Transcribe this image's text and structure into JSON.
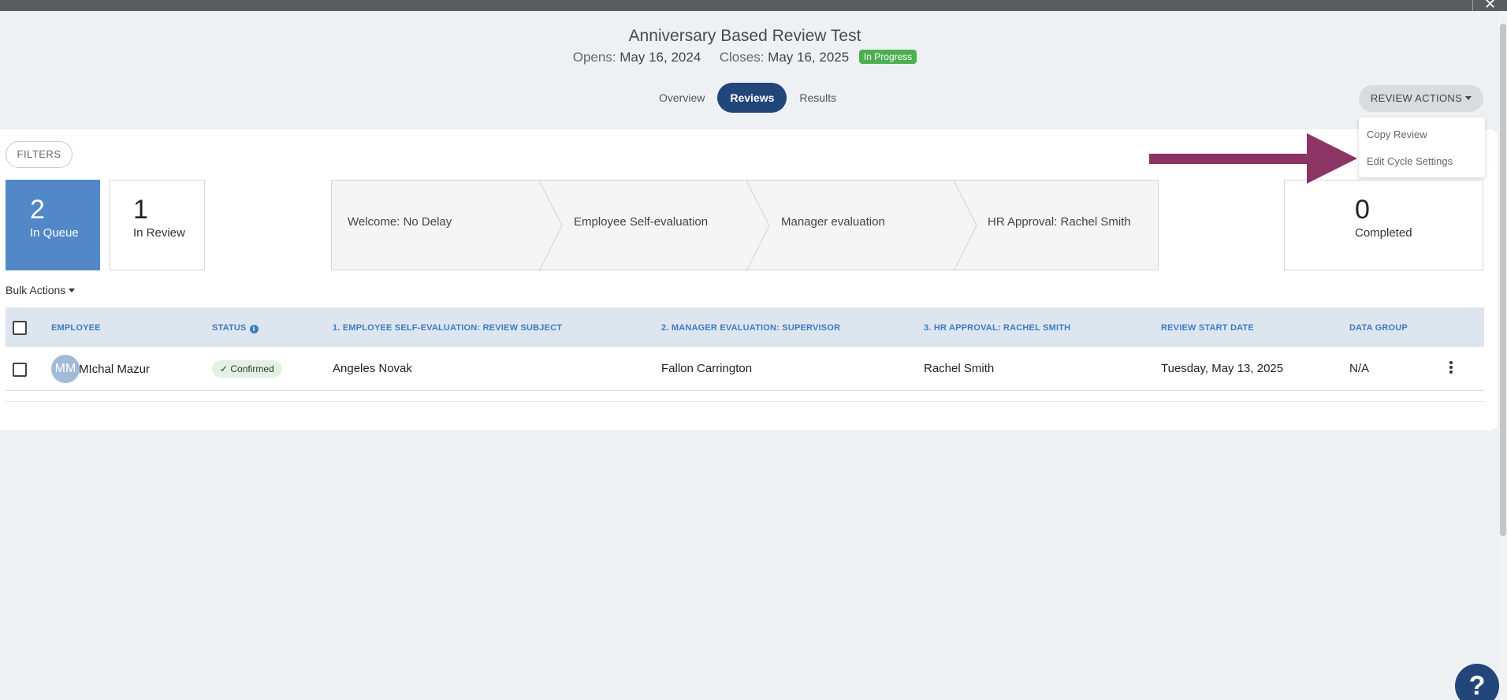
{
  "header": {
    "title": "Anniversary Based Review Test",
    "opens_label": "Opens:",
    "opens_date": "May 16, 2024",
    "closes_label": "Closes:",
    "closes_date": "May 16, 2025",
    "status_badge": "In Progress",
    "close_icon": "✕"
  },
  "tabs": [
    {
      "label": "Overview",
      "active": false
    },
    {
      "label": "Reviews",
      "active": true
    },
    {
      "label": "Results",
      "active": false
    }
  ],
  "review_actions": {
    "label": "REVIEW ACTIONS",
    "menu": [
      "Copy Review",
      "Edit Cycle Settings"
    ]
  },
  "filters_label": "FILTERS",
  "stats": {
    "in_queue": {
      "count": "2",
      "label": "In Queue"
    },
    "in_review": {
      "count": "1",
      "label": "In Review"
    },
    "completed": {
      "count": "0",
      "label": "Completed"
    }
  },
  "pipeline": [
    "Welcome: No Delay",
    "Employee Self-evaluation",
    "Manager evaluation",
    "HR Approval: Rachel Smith"
  ],
  "bulk_actions_label": "Bulk Actions",
  "table": {
    "columns": [
      "EMPLOYEE",
      "STATUS",
      "1. EMPLOYEE SELF-EVALUATION: REVIEW SUBJECT",
      "2. MANAGER EVALUATION: SUPERVISOR",
      "3. HR APPROVAL: RACHEL SMITH",
      "REVIEW START DATE",
      "DATA GROUP"
    ],
    "rows": [
      {
        "initials": "MM",
        "employee": "MIchal Mazur",
        "status": "Confirmed",
        "self_eval": "Angeles Novak",
        "manager_eval": "Fallon Carrington",
        "hr_approval": "Rachel Smith",
        "start_date": "Tuesday, May 13, 2025",
        "data_group": "N/A"
      }
    ]
  },
  "help_label": "?",
  "colors": {
    "primary": "#22467a",
    "queue_blue": "#5288c7",
    "success": "#4caf50",
    "arrow": "#8b3565",
    "header_link": "#3f7ac4"
  }
}
